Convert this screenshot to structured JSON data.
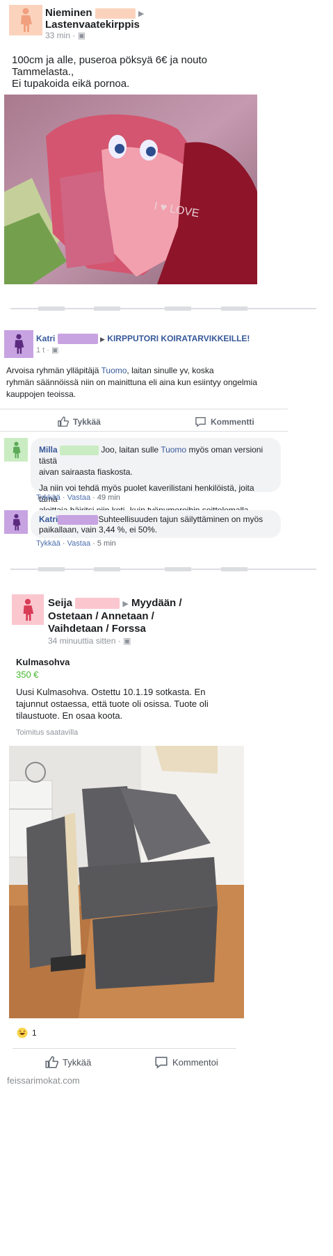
{
  "post1": {
    "author_first": "Nieminen",
    "group": "Lastenvaatekirppis",
    "time": "33 min",
    "text_lines": [
      "100cm ja alle, puseroa pöksyä 6€ ja nouto",
      "Tammelasta.,",
      "Ei tupakoida eikä pornoa."
    ]
  },
  "post2": {
    "author_first": "Katri",
    "group": "KIRPPUTORI KOIRATARVIKKEILLE!",
    "time": "1 t",
    "text_pre": "Arvoisa ryhmän ylläpitäjä ",
    "text_link": "Tuomo",
    "text_post": ", laitan sinulle yv, koska",
    "text_line2": "ryhmän säännöissä niin on mainittuna eli aina kun esiintyy ongelmia",
    "text_line3": "kauppojen teoissa.",
    "like_label": "Tykkää",
    "comment_label": "Kommentti",
    "comments": [
      {
        "author": "Milla",
        "line1_pre": "Joo, laitan sulle ",
        "line1_link": "Tuomo",
        "line1_post": " myös oman versioni tästä",
        "line2": "aivan sairaasta fiaskosta.",
        "line3": "Ja niin voi tehdä myös puolet kaverilistani henkilöistä, joita tämä",
        "line4": "aloittaja häiritsi niin koti- kuin työnumeroihin soittelemalla...",
        "like": "Tykkää",
        "reply": "Vastaa",
        "time": "49 min"
      },
      {
        "author": "Katri",
        "line1": "Suhteellisuuden tajun säilyttäminen on myös",
        "line2": "paikallaan, vain 3,44 %, ei 50%.",
        "like": "Tykkää",
        "reply": "Vastaa",
        "time": "5 min"
      }
    ]
  },
  "post3": {
    "author_first": "Seija",
    "group_lines": [
      "Myydään /",
      "Ostetaan / Annetaan /",
      "Vaihdetaan / Forssa"
    ],
    "time": "34 minuuttia sitten",
    "item_title": "Kulmasohva",
    "price": "350 €",
    "text_lines": [
      "Uusi Kulmasohva. Ostettu 10.1.19 sotkasta. En",
      "tajunnut ostaessa, että tuote oli osissa. Tuote oli",
      "tilaustuote. En osaa koota."
    ],
    "shipping": "Toimitus saatavilla",
    "reaction_count": "1",
    "like_label": "Tykkää",
    "comment_label": "Kommentoi"
  },
  "watermark": "feissarimokat.com",
  "colors": {
    "avatar_orange": "#fbd3bd",
    "avatar_orange_fig": "#f0a07e",
    "avatar_purple": "#c7a3e2",
    "avatar_purple_fig": "#5b2a7e",
    "avatar_green": "#c9ecc2",
    "avatar_green_fig": "#5dab59",
    "avatar_pink": "#fbc7cf",
    "avatar_pink_fig": "#d83c56",
    "link": "#365899",
    "price": "#42b72a"
  }
}
